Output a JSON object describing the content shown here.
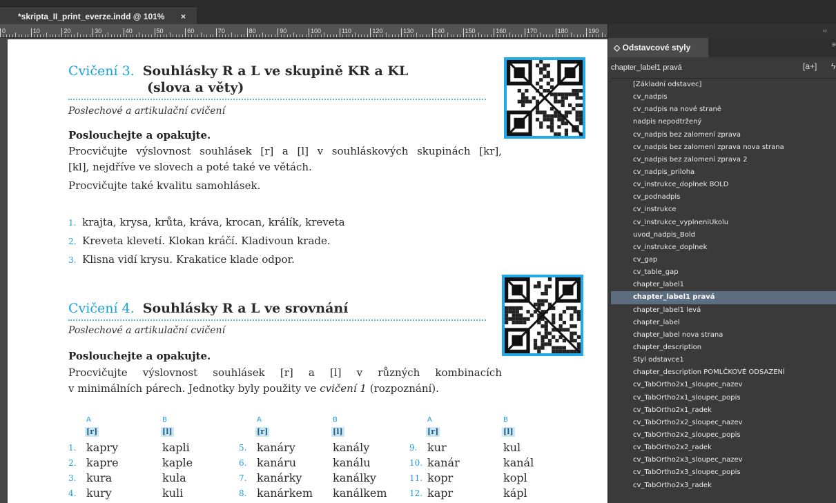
{
  "document_tab": {
    "title": "*skripta_II_print_everze.indd @ 101%",
    "close": "×"
  },
  "ruler": {
    "labels": [
      "0",
      "10",
      "20",
      "30",
      "40",
      "50",
      "60",
      "70",
      "80",
      "90",
      "100",
      "110",
      "120",
      "130",
      "140",
      "150",
      "160",
      "170",
      "180",
      "190"
    ]
  },
  "exercise3": {
    "number": "Cvičení 3.",
    "title_line1": "Souhlásky R a L ve skupině KR a KL",
    "title_line2": "(slova a věty)",
    "subtitle": "Poslechové a artikulační cvičení",
    "instruction": "Poslouchejte a opakujte.",
    "para1": "Procvičujte výslovnost souhlásek [r] a [l] v souhláskových skupinách [kr],",
    "para2": "[kl], nejdříve ve slovech a poté také ve větách.",
    "para3": "Procvičujte také kvalitu samohlásek.",
    "items": [
      {
        "num": "1.",
        "text": "krajta, krysa, krůta, kráva, krocan, králík, kreveta"
      },
      {
        "num": "2.",
        "text": "Kreveta klevetí. Klokan kráčí. Kladivoun krade."
      },
      {
        "num": "3.",
        "text": "Klisna vidí krysu. Krakatice klade odpor."
      }
    ]
  },
  "exercise4": {
    "number": "Cvičení 4.",
    "title": "Souhlásky R a L ve srovnání",
    "subtitle": "Poslechové a artikulační cvičení",
    "instruction": "Poslouchejte a opakujte.",
    "para1": "Procvičujte výslovnost souhlásek [r] a [l] v různých kombinacích",
    "para2_pre": "v minimálních párech. Jednotky byly použity ve ",
    "para2_em": "cvičení 1",
    "para2_post": " (rozpoznání).",
    "columns": [
      {
        "a_head": "A",
        "b_head": "B",
        "a_phon": "[r]",
        "b_phon": "[l]",
        "rows": [
          {
            "num": "1.",
            "a": "kapry",
            "b": "kapli"
          },
          {
            "num": "2.",
            "a": "kapre",
            "b": "kaple"
          },
          {
            "num": "3.",
            "a": "kura",
            "b": "kula"
          },
          {
            "num": "4.",
            "a": "kury",
            "b": "kuli"
          }
        ]
      },
      {
        "a_head": "A",
        "b_head": "B",
        "a_phon": "[r]",
        "b_phon": "[l]",
        "rows": [
          {
            "num": "5.",
            "a": "kanáry",
            "b": "kanály"
          },
          {
            "num": "6.",
            "a": "kanáru",
            "b": "kanálu"
          },
          {
            "num": "7.",
            "a": "kanárky",
            "b": "kanálky"
          },
          {
            "num": "8.",
            "a": "kanárkem",
            "b": "kanálkem"
          }
        ]
      },
      {
        "a_head": "A",
        "b_head": "B",
        "a_phon": "[r]",
        "b_phon": "[l]",
        "rows": [
          {
            "num": "9.",
            "a": "kur",
            "b": "kul"
          },
          {
            "num": "10.",
            "a": "kanár",
            "b": "kanál"
          },
          {
            "num": "11.",
            "a": "kopr",
            "b": "kopl"
          },
          {
            "num": "12.",
            "a": "kapr",
            "b": "kápl"
          }
        ]
      }
    ]
  },
  "panel": {
    "collapse_glyph": "‹‹",
    "tab_title": "◇ Odstavcové styly",
    "menu_glyph": "≡",
    "current_style": "chapter_label1 pravá",
    "new_style_glyph": "[a+]",
    "lightning_glyph": "ϟ",
    "styles": [
      "[Základní odstavec]",
      "cv_nadpis",
      "cv_nadpis na nové straně",
      "nadpis nepodtržený",
      "cv_nadpis bez zalomení zprava",
      "cv_nadpis bez zalomení zprava nova strana",
      "cv_nadpis bez zalomení zprava 2",
      "cv_nadpis_priloha",
      "cv_instrukce_doplnek BOLD",
      "cv_podnadpis",
      "cv_instrukce",
      "cv_instrukce_vyplneniUkolu",
      "uvod_nadpis_Bold",
      "cv_instrukce_doplnek",
      "cv_gap",
      "cv_table_gap",
      "chapter_label1",
      "chapter_label1 pravá",
      "chapter_label1 levá",
      "chapter_label",
      "chapter_label nova strana",
      "chapter_description",
      "Styl odstavce1",
      "chapter_description POMLČKOVÉ ODSAZENÍ",
      "cv_TabOrtho2x1_sloupec_nazev",
      "cv_TabOrtho2x1_sloupec_popis",
      "cv_TabOrtho2x1_radek",
      "cv_TabOrtho2x2_sloupec_nazev",
      "cv_TabOrtho2x2_sloupec_popis",
      "cv_TabOrtho2x2_radek",
      "cv_TabOrtho2x3_sloupec_nazev",
      "cv_TabOrtho2x3_sloupec_popis",
      "cv_TabOrtho2x3_radek"
    ],
    "selected_index": 17,
    "colors": {
      "selected_bg": "#5c6d80",
      "accent": "#1aa0d8"
    }
  }
}
